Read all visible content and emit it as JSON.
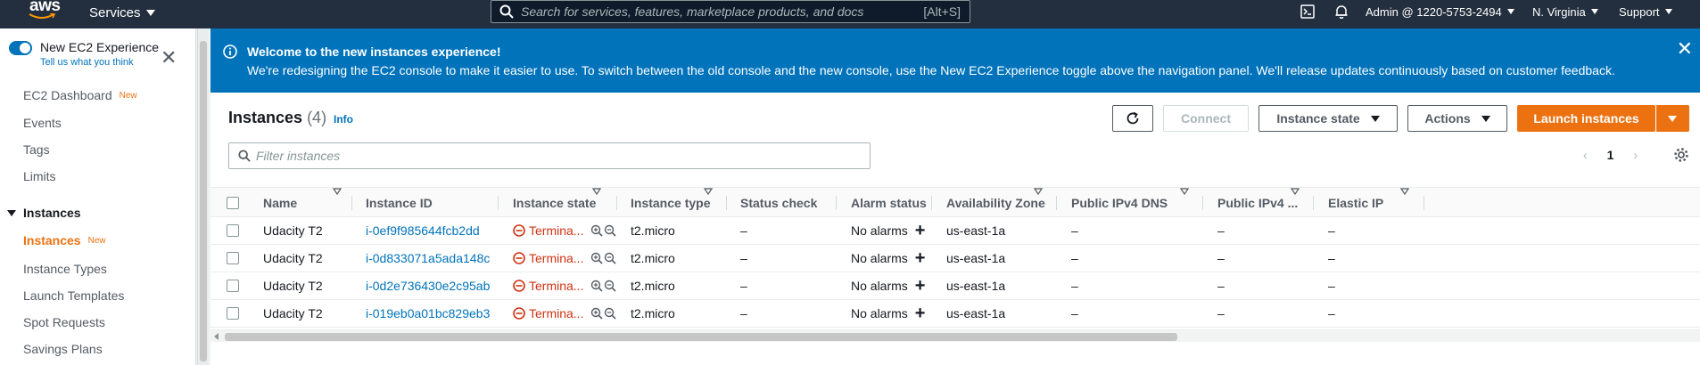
{
  "topnav": {
    "logo": "aws",
    "services_label": "Services",
    "search_placeholder": "Search for services, features, marketplace products, and docs",
    "search_shortcut": "[Alt+S]",
    "account": "Admin @ 1220-5753-2494",
    "region": "N. Virginia",
    "support": "Support",
    "icons": [
      "cloudshell-icon",
      "bell-icon"
    ]
  },
  "sidebar": {
    "experience_title": "New EC2 Experience",
    "experience_sub": "Tell us what you think",
    "items": [
      {
        "label": "EC2 Dashboard",
        "badge": "New"
      },
      {
        "label": "Events"
      },
      {
        "label": "Tags"
      },
      {
        "label": "Limits"
      }
    ],
    "section": "Instances",
    "section_items": [
      {
        "label": "Instances",
        "badge": "New",
        "active": true
      },
      {
        "label": "Instance Types"
      },
      {
        "label": "Launch Templates"
      },
      {
        "label": "Spot Requests"
      },
      {
        "label": "Savings Plans"
      }
    ]
  },
  "banner": {
    "title": "Welcome to the new instances experience!",
    "body": "We're redesigning the EC2 console to make it easier to use. To switch between the old console and the new console, use the New EC2 Experience toggle above the navigation panel. We'll release updates continuously based on customer feedback."
  },
  "panel": {
    "title": "Instances",
    "count": "(4)",
    "info": "Info",
    "buttons": {
      "connect": "Connect",
      "instance_state": "Instance state",
      "actions": "Actions",
      "launch": "Launch instances"
    },
    "filter_placeholder": "Filter instances",
    "page": "1"
  },
  "table": {
    "columns": [
      "Name",
      "Instance ID",
      "Instance state",
      "Instance type",
      "Status check",
      "Alarm status",
      "Availability Zone",
      "Public IPv4 DNS",
      "Public IPv4 ...",
      "Elastic IP"
    ],
    "rows": [
      {
        "name": "Udacity T2",
        "id": "i-0ef9f985644fcb2dd",
        "state": "Termina...",
        "type": "t2.micro",
        "status": "–",
        "alarm": "No alarms",
        "az": "us-east-1a",
        "dns": "–",
        "ipv4": "–",
        "eip": "–"
      },
      {
        "name": "Udacity T2",
        "id": "i-0d833071a5ada148c",
        "state": "Termina...",
        "type": "t2.micro",
        "status": "–",
        "alarm": "No alarms",
        "az": "us-east-1a",
        "dns": "–",
        "ipv4": "–",
        "eip": "–"
      },
      {
        "name": "Udacity T2",
        "id": "i-0d2e736430e2c95ab",
        "state": "Termina...",
        "type": "t2.micro",
        "status": "–",
        "alarm": "No alarms",
        "az": "us-east-1a",
        "dns": "–",
        "ipv4": "–",
        "eip": "–"
      },
      {
        "name": "Udacity T2",
        "id": "i-019eb0a01bc829eb3",
        "state": "Termina...",
        "type": "t2.micro",
        "status": "–",
        "alarm": "No alarms",
        "az": "us-east-1a",
        "dns": "–",
        "ipv4": "–",
        "eip": "–"
      }
    ]
  },
  "colors": {
    "nav": "#232f3e",
    "banner": "#0073bb",
    "accent": "#ec7211",
    "terminated": "#d13212",
    "link": "#0073bb"
  }
}
